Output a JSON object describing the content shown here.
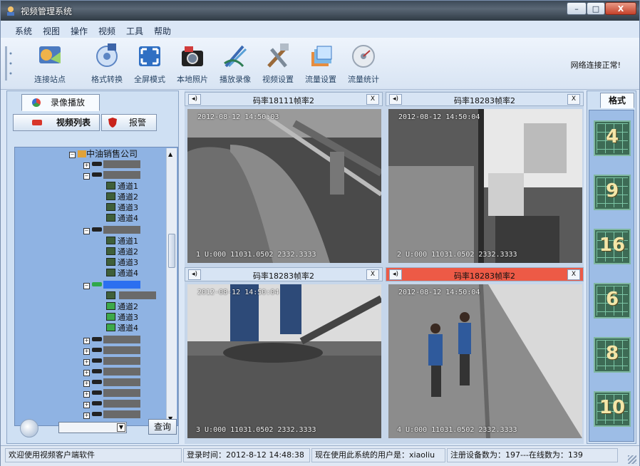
{
  "window": {
    "title": "视频管理系统",
    "controls": {
      "minimize": "–",
      "maximize": "□",
      "close": "X"
    }
  },
  "menu": [
    "系统",
    "视图",
    "操作",
    "视频",
    "工具",
    "帮助"
  ],
  "toolbar": {
    "items": [
      {
        "label": "连接站点",
        "icon": "connect-site-icon"
      },
      {
        "label": "格式转换",
        "icon": "format-convert-icon"
      },
      {
        "label": "全屏模式",
        "icon": "fullscreen-icon"
      },
      {
        "label": "本地照片",
        "icon": "camera-icon"
      },
      {
        "label": "播放录像",
        "icon": "play-recording-icon"
      },
      {
        "label": "视频设置",
        "icon": "tools-icon"
      },
      {
        "label": "流量设置",
        "icon": "traffic-settings-icon"
      },
      {
        "label": "流量统计",
        "icon": "traffic-stats-icon"
      }
    ],
    "network_status": "网络连接正常!"
  },
  "left_panel": {
    "tab_playback": "录像播放",
    "tab_video_list": "视频列表",
    "tab_alarm": "报警",
    "tree": {
      "root": "中油销售公司",
      "channels_a": [
        "通道1",
        "通道2",
        "通道3",
        "通道4"
      ],
      "channels_b": [
        "通道1",
        "通道2",
        "通道3",
        "通道4"
      ],
      "channels_c": [
        "通道2",
        "通道3",
        "通道4"
      ]
    },
    "query_button": "查询"
  },
  "videos": [
    {
      "title": "码率18111帧率2",
      "timestamp": "2012-08-12 14:50:03",
      "footer": "1 U:000 11031.0502 2332.3333",
      "close": "X",
      "alert": false
    },
    {
      "title": "码率18283帧率2",
      "timestamp": "2012-08-12 14:50:04",
      "footer": "2 U:000 11031.0502 2332.3333",
      "close": "X",
      "alert": false
    },
    {
      "title": "码率18283帧率2",
      "timestamp": "2012-08-12 14:50:04",
      "footer": "3 U:000 11031.0502 2332.3333",
      "close": "X",
      "alert": false
    },
    {
      "title": "码率18283帧率2",
      "timestamp": "2012-08-12 14:50:04",
      "footer": "4 U:000 11031.0502 2332.3333",
      "close": "X",
      "alert": true
    }
  ],
  "right_panel": {
    "tab_label": "格式",
    "layouts": [
      "4",
      "9",
      "16",
      "6",
      "8",
      "10"
    ]
  },
  "status_bar": {
    "welcome": "欢迎使用视频客户端软件",
    "login_time": "登录时间：2012-8-12 14:48:38",
    "current_user": "现在使用此系统的用户是：xiaoliu",
    "device_stats": "注册设备数为：197---在线数为：139"
  },
  "colors": {
    "alert_header": "#ed5a46",
    "tree_bg": "#8fb3e3",
    "layout_btn": "#3d6b55"
  }
}
